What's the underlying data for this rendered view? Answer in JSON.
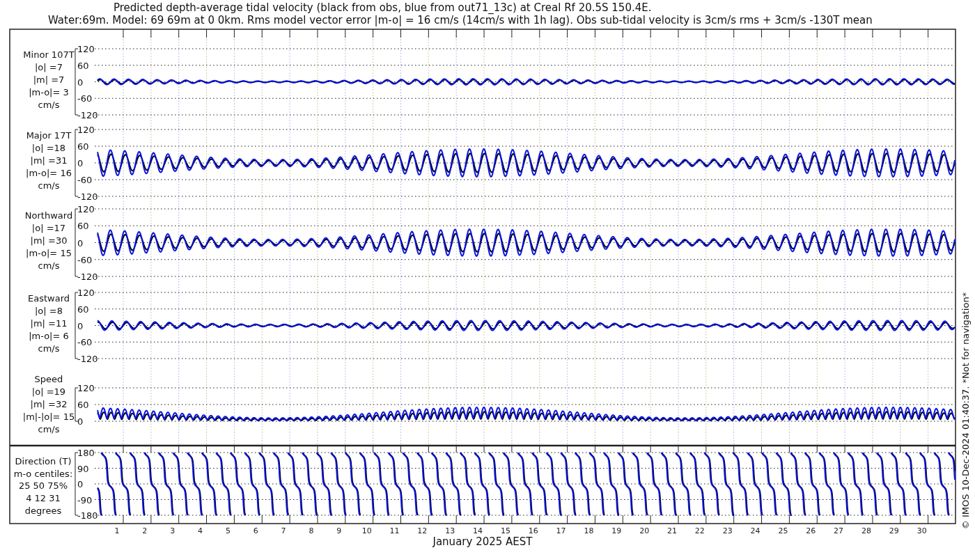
{
  "title_lines": [
    "Predicted depth-average tidal velocity (black from obs, blue from out71_13c) at Creal Rf 20.5S 150.4E.",
    "Water:69m. Model: 69 69m at 0 0km. Rms model vector error |m-o| = 16 cm/s (14cm/s with 1h lag). Obs sub-tidal velocity is 3cm/s rms + 3cm/s -130T mean"
  ],
  "panels": [
    {
      "kind": "velocity",
      "label_lines": [
        "Minor 107T",
        "|o| =7",
        "|m| =7",
        "|m-o|= 3",
        "cm/s"
      ],
      "yticks": [
        "120",
        "60",
        "0",
        "-60",
        "-120"
      ]
    },
    {
      "kind": "velocity",
      "label_lines": [
        "Major 17T",
        "|o| =18",
        "|m| =31",
        "|m-o|= 16",
        "cm/s"
      ],
      "yticks": [
        "120",
        "60",
        "0",
        "-60",
        "-120"
      ]
    },
    {
      "kind": "velocity",
      "label_lines": [
        "Northward",
        "|o| =17",
        "|m| =30",
        "|m-o|= 15",
        "cm/s"
      ],
      "yticks": [
        "120",
        "60",
        "0",
        "-60",
        "-120"
      ]
    },
    {
      "kind": "velocity",
      "label_lines": [
        "Eastward",
        "|o| =8",
        "|m| =11",
        "|m-o|= 6",
        "cm/s"
      ],
      "yticks": [
        "120",
        "60",
        "0",
        "-60",
        "-120"
      ]
    },
    {
      "kind": "speed",
      "label_lines": [
        "Speed",
        "|o| =19",
        "|m| =32",
        "|m|-|o|= 15",
        "cm/s"
      ],
      "yticks": [
        "120",
        "60",
        "0"
      ]
    },
    {
      "kind": "direction",
      "label_lines": [
        "Direction (T)",
        "m-o centiles:",
        "25  50  75%",
        "4  12  31",
        "degrees"
      ],
      "yticks": [
        "180",
        "90",
        "0",
        "-90",
        "-180"
      ]
    }
  ],
  "xticks": [
    "1",
    "2",
    "3",
    "4",
    "5",
    "6",
    "7",
    "8",
    "9",
    "10",
    "11",
    "12",
    "13",
    "14",
    "15",
    "16",
    "17",
    "18",
    "19",
    "20",
    "21",
    "22",
    "23",
    "24",
    "25",
    "26",
    "27",
    "28",
    "29",
    "30"
  ],
  "xlabel": "January 2025 AEST",
  "credit": "© IMOS 10-Dec-2024 01:40:37. *Not for navigation*"
}
